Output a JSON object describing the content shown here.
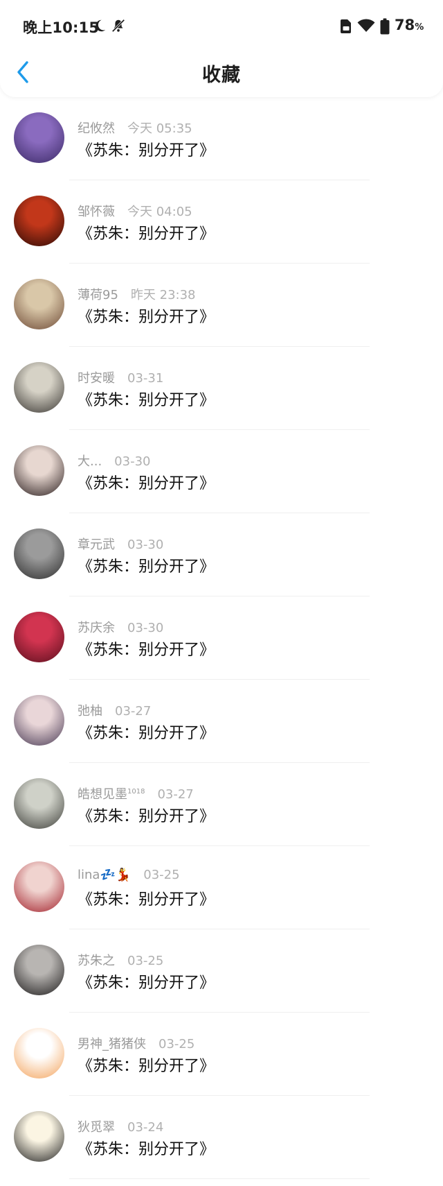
{
  "status_bar": {
    "time": "晚上10:15",
    "battery": "78",
    "battery_unit": "%"
  },
  "header": {
    "title": "收藏"
  },
  "items": [
    {
      "name": "纪攸然",
      "time": "今天 05:35",
      "title": "《苏朱：别分开了》",
      "avatar_colors": [
        "#8a6bbf",
        "#3b2a66"
      ]
    },
    {
      "name": "邹怀薇",
      "time": "今天 04:05",
      "title": "《苏朱：别分开了》",
      "avatar_colors": [
        "#c2371a",
        "#2a0a05"
      ]
    },
    {
      "name": "薄荷95",
      "time": "昨天 23:38",
      "title": "《苏朱：别分开了》",
      "avatar_colors": [
        "#d9c7a8",
        "#6e4a36"
      ]
    },
    {
      "name": "时安暖",
      "time": "03-31",
      "title": "《苏朱：别分开了》",
      "avatar_colors": [
        "#d6d2c6",
        "#3a3733"
      ]
    },
    {
      "name": "大...",
      "time": "03-30",
      "title": "《苏朱：别分开了》",
      "avatar_colors": [
        "#e7d7d0",
        "#2b1f1f"
      ]
    },
    {
      "name": "章元武",
      "time": "03-30",
      "title": "《苏朱：别分开了》",
      "avatar_colors": [
        "#9b9b9b",
        "#2d2d2d"
      ]
    },
    {
      "name": "苏庆余",
      "time": "03-30",
      "title": "《苏朱：别分开了》",
      "avatar_colors": [
        "#d23450",
        "#5a0f1d"
      ]
    },
    {
      "name": "弛柚",
      "time": "03-27",
      "title": "《苏朱：别分开了》",
      "avatar_colors": [
        "#e9d6d8",
        "#4a3b55"
      ]
    },
    {
      "name": "皓想见墨",
      "name_sup": "1018",
      "time": "03-27",
      "title": "《苏朱：别分开了》",
      "avatar_colors": [
        "#cfd1c8",
        "#3e3f3a"
      ]
    },
    {
      "name": "lina💤💃",
      "time": "03-25",
      "title": "《苏朱：别分开了》",
      "avatar_colors": [
        "#f0d3cf",
        "#a3222c"
      ]
    },
    {
      "name": "苏朱之",
      "time": "03-25",
      "title": "《苏朱：别分开了》",
      "avatar_colors": [
        "#b8b5b2",
        "#1e1c1c"
      ]
    },
    {
      "name": "男神_猪猪侠",
      "time": "03-25",
      "title": "《苏朱：别分开了》",
      "avatar_colors": [
        "#ffffff",
        "#f3a35c"
      ]
    },
    {
      "name": "狄觅翠",
      "time": "03-24",
      "title": "《苏朱：别分开了》",
      "avatar_colors": [
        "#fbf5e3",
        "#222222"
      ]
    }
  ],
  "colors": {
    "accent": "#1e9bea",
    "meta_text": "#9a9a9a",
    "title_text": "#111111"
  },
  "icons": {
    "back": "chevron-left-icon",
    "moon": "moon-icon",
    "notifications_off": "bell-off-icon",
    "sim": "sim-card-icon",
    "wifi": "wifi-icon",
    "battery": "battery-icon"
  }
}
